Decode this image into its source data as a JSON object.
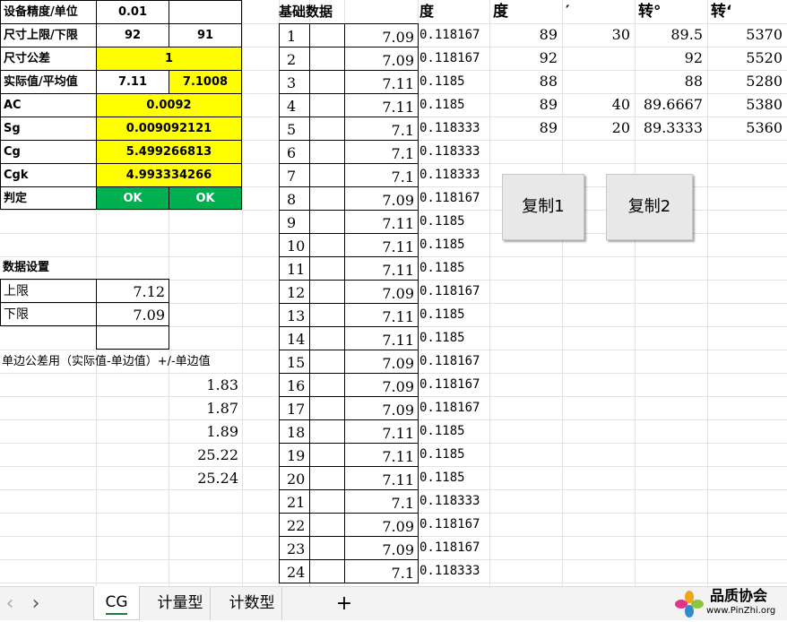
{
  "left": {
    "precision": {
      "label": "设备精度/单位",
      "value": "0.01"
    },
    "size_limits": {
      "label": "尺寸上限/下限",
      "upper": "92",
      "lower": "91"
    },
    "tolerance": {
      "label": "尺寸公差",
      "value": "1"
    },
    "actual_avg": {
      "label": "实际值/平均值",
      "actual": "7.11",
      "avg": "7.1008"
    },
    "ac": {
      "label": "AC",
      "value": "0.0092"
    },
    "sg": {
      "label": "Sg",
      "value": "0.009092121"
    },
    "cg": {
      "label": "Cg",
      "value": "5.499266813"
    },
    "cgk": {
      "label": "Cgk",
      "value": "4.993334266"
    },
    "judge": {
      "label": "判定",
      "v1": "OK",
      "v2": "OK"
    },
    "settings_title": "数据设置",
    "upper": {
      "label": "上限",
      "value": "7.12"
    },
    "lower": {
      "label": "下限",
      "value": "7.09"
    },
    "note": "单边公差用（实际值-单边值）+/-单边值",
    "extra_values": [
      "1.83",
      "1.87",
      "1.89",
      "25.22",
      "25.24"
    ]
  },
  "basic": {
    "title": "基础数据",
    "deg_header": "度",
    "rows": [
      {
        "n": "1",
        "v": "7.09",
        "d": "0.118167"
      },
      {
        "n": "2",
        "v": "7.09",
        "d": "0.118167"
      },
      {
        "n": "3",
        "v": "7.11",
        "d": "0.1185"
      },
      {
        "n": "4",
        "v": "7.11",
        "d": "0.1185"
      },
      {
        "n": "5",
        "v": "7.1",
        "d": "0.118333"
      },
      {
        "n": "6",
        "v": "7.1",
        "d": "0.118333"
      },
      {
        "n": "7",
        "v": "7.1",
        "d": "0.118333"
      },
      {
        "n": "8",
        "v": "7.09",
        "d": "0.118167"
      },
      {
        "n": "9",
        "v": "7.11",
        "d": "0.1185"
      },
      {
        "n": "10",
        "v": "7.11",
        "d": "0.1185"
      },
      {
        "n": "11",
        "v": "7.11",
        "d": "0.1185"
      },
      {
        "n": "12",
        "v": "7.09",
        "d": "0.118167"
      },
      {
        "n": "13",
        "v": "7.11",
        "d": "0.1185"
      },
      {
        "n": "14",
        "v": "7.11",
        "d": "0.1185"
      },
      {
        "n": "15",
        "v": "7.09",
        "d": "0.118167"
      },
      {
        "n": "16",
        "v": "7.09",
        "d": "0.118167"
      },
      {
        "n": "17",
        "v": "7.09",
        "d": "0.118167"
      },
      {
        "n": "18",
        "v": "7.11",
        "d": "0.1185"
      },
      {
        "n": "19",
        "v": "7.11",
        "d": "0.1185"
      },
      {
        "n": "20",
        "v": "7.11",
        "d": "0.1185"
      },
      {
        "n": "21",
        "v": "7.1",
        "d": "0.118333"
      },
      {
        "n": "22",
        "v": "7.09",
        "d": "0.118167"
      },
      {
        "n": "23",
        "v": "7.09",
        "d": "0.118167"
      },
      {
        "n": "24",
        "v": "7.1",
        "d": "0.118333"
      }
    ]
  },
  "conv": {
    "headers": [
      "度",
      "′",
      "转°",
      "转‘"
    ],
    "rows": [
      [
        "89",
        "30",
        "89.5",
        "5370"
      ],
      [
        "92",
        "",
        "92",
        "5520"
      ],
      [
        "88",
        "",
        "88",
        "5280"
      ],
      [
        "89",
        "40",
        "89.6667",
        "5380"
      ],
      [
        "89",
        "20",
        "89.3333",
        "5360"
      ]
    ]
  },
  "buttons": {
    "copy1": "复制1",
    "copy2": "复制2"
  },
  "tabs": {
    "prev": "‹",
    "next": "›",
    "items": [
      "CG",
      "计量型",
      "计数型"
    ],
    "add": "+"
  },
  "logo": {
    "name": "品质协会",
    "url": "www.PinZhi.org"
  }
}
